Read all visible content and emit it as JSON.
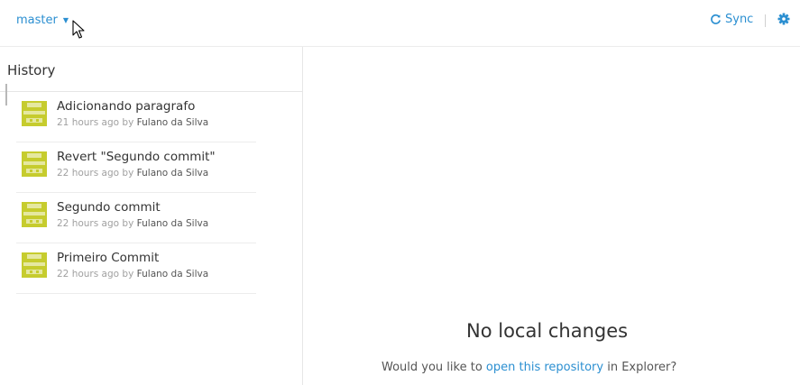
{
  "topbar": {
    "branch": "master",
    "sync_label": "Sync"
  },
  "sidebar": {
    "title": "History",
    "commits": [
      {
        "title": "Adicionando paragrafo",
        "time": "21 hours ago by",
        "author": "Fulano da Silva"
      },
      {
        "title": "Revert \"Segundo commit\"",
        "time": "22 hours ago by",
        "author": "Fulano da Silva"
      },
      {
        "title": "Segundo commit",
        "time": "22 hours ago by",
        "author": "Fulano da Silva"
      },
      {
        "title": "Primeiro Commit",
        "time": "22 hours ago by",
        "author": "Fulano da Silva"
      }
    ]
  },
  "main": {
    "empty_title": "No local changes",
    "prompt_prefix": "Would you like to",
    "prompt_link": "open this repository",
    "prompt_suffix": "in Explorer?"
  },
  "colors": {
    "accent": "#2b8fd1",
    "avatar": "#c6cc2e"
  }
}
